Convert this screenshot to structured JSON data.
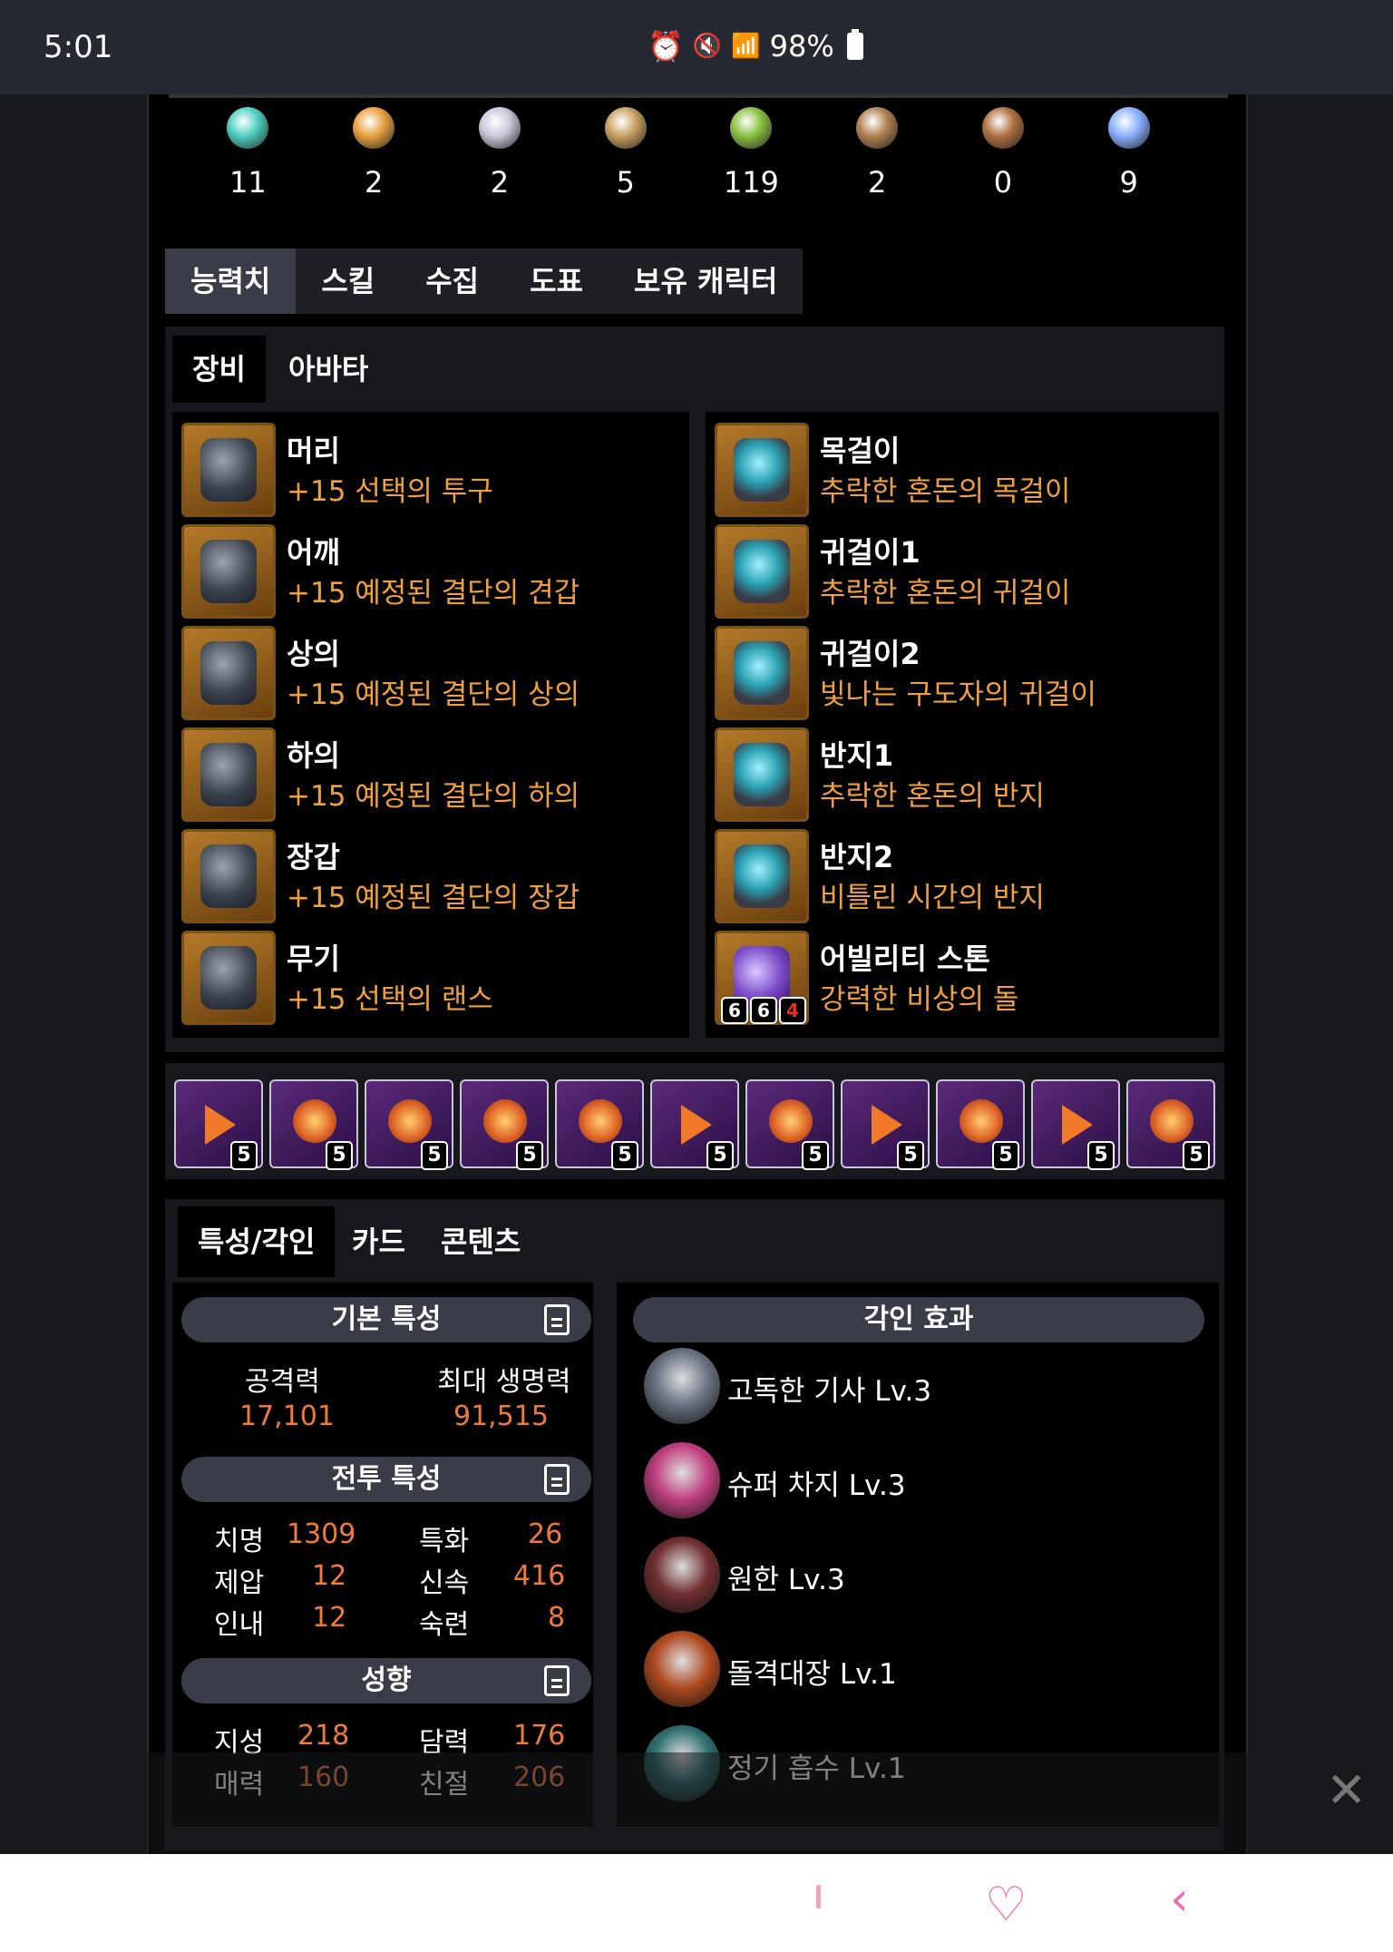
{
  "status_bar": {
    "time": "5:01",
    "battery": "98%"
  },
  "resources": [
    {
      "icon": "orb-icon",
      "value": "11",
      "color": "#4fd0c0"
    },
    {
      "icon": "star-shard-icon",
      "value": "2",
      "color": "#e8a040"
    },
    {
      "icon": "heart-seed-icon",
      "value": "2",
      "color": "#c8c8d8"
    },
    {
      "icon": "map-icon",
      "value": "5",
      "color": "#c8a060"
    },
    {
      "icon": "sprout-icon",
      "value": "119",
      "color": "#8ac040"
    },
    {
      "icon": "telescope-icon",
      "value": "2",
      "color": "#b08050"
    },
    {
      "icon": "mask-icon",
      "value": "0",
      "color": "#b07040"
    },
    {
      "icon": "crystal-flower-icon",
      "value": "9",
      "color": "#8ab0ff"
    }
  ],
  "main_tabs": [
    "능력치",
    "스킬",
    "수집",
    "도표",
    "보유 캐릭터"
  ],
  "equip_tabs": [
    "장비",
    "아바타"
  ],
  "equipment_left": [
    {
      "slot": "머리",
      "name": "+15 선택의 투구"
    },
    {
      "slot": "어깨",
      "name": "+15 예정된 결단의 견갑"
    },
    {
      "slot": "상의",
      "name": "+15 예정된 결단의 상의"
    },
    {
      "slot": "하의",
      "name": "+15 예정된 결단의 하의"
    },
    {
      "slot": "장갑",
      "name": "+15 예정된 결단의 장갑"
    },
    {
      "slot": "무기",
      "name": "+15 선택의 랜스"
    }
  ],
  "equipment_right": [
    {
      "slot": "목걸이",
      "name": "추락한 혼돈의 목걸이"
    },
    {
      "slot": "귀걸이1",
      "name": "추락한 혼돈의 귀걸이"
    },
    {
      "slot": "귀걸이2",
      "name": "빛나는 구도자의 귀걸이"
    },
    {
      "slot": "반지1",
      "name": "추락한 혼돈의 반지"
    },
    {
      "slot": "반지2",
      "name": "비틀린 시간의 반지"
    },
    {
      "slot": "어빌리티 스톤",
      "name": "강력한 비상의 돌"
    }
  ],
  "stone_levels": [
    "6",
    "6",
    "4"
  ],
  "gems": [
    {
      "type": "tri",
      "level": "5"
    },
    {
      "type": "orb",
      "level": "5"
    },
    {
      "type": "orb",
      "level": "5"
    },
    {
      "type": "orb",
      "level": "5"
    },
    {
      "type": "orb",
      "level": "5"
    },
    {
      "type": "tri",
      "level": "5"
    },
    {
      "type": "orb",
      "level": "5"
    },
    {
      "type": "tri",
      "level": "5"
    },
    {
      "type": "orb",
      "level": "5"
    },
    {
      "type": "tri",
      "level": "5"
    },
    {
      "type": "orb",
      "level": "5"
    }
  ],
  "stat_tabs": [
    "특성/각인",
    "카드",
    "콘텐츠"
  ],
  "basic_stats": {
    "title": "기본 특성",
    "attack_label": "공격력",
    "attack_value": "17,101",
    "hp_label": "최대 생명력",
    "hp_value": "91,515"
  },
  "combat_stats": {
    "title": "전투 특성",
    "rows": [
      {
        "l1": "치명",
        "v1": "1309",
        "l2": "특화",
        "v2": "26"
      },
      {
        "l1": "제압",
        "v1": "12",
        "l2": "신속",
        "v2": "416"
      },
      {
        "l1": "인내",
        "v1": "12",
        "l2": "숙련",
        "v2": "8"
      }
    ]
  },
  "tendency": {
    "title": "성향",
    "rows": [
      {
        "l1": "지성",
        "v1": "218",
        "l2": "담력",
        "v2": "176"
      },
      {
        "l1": "매력",
        "v1": "160",
        "l2": "친절",
        "v2": "206"
      }
    ]
  },
  "engraving": {
    "title": "각인 효과",
    "items": [
      {
        "name": "고독한 기사 Lv.3",
        "color": "#6a7080"
      },
      {
        "name": "슈퍼 차지 Lv.3",
        "color": "#c04080"
      },
      {
        "name": "원한 Lv.3",
        "color": "#703030"
      },
      {
        "name": "돌격대장 Lv.1",
        "color": "#b04a20"
      },
      {
        "name": "정기 흡수 Lv.1",
        "color": "#307070"
      }
    ]
  }
}
